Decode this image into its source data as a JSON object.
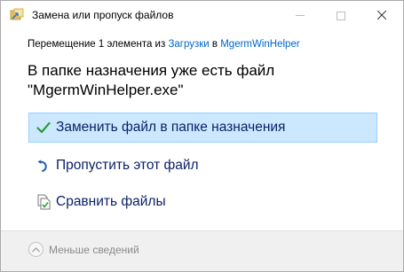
{
  "window": {
    "title": "Замена или пропуск файлов"
  },
  "subtitle": {
    "prefix": "Перемещение 1 элемента из ",
    "source": "Загрузки",
    "middle": " в ",
    "destination": "MgermWinHelper"
  },
  "heading": {
    "line1": "В папке назначения уже есть файл",
    "line2": "\"MgermWinHelper.exe\""
  },
  "options": [
    {
      "label": "Заменить файл в папке назначения",
      "icon": "check-icon",
      "selected": true
    },
    {
      "label": "Пропустить этот файл",
      "icon": "skip-arrow-icon",
      "selected": false
    },
    {
      "label": "Сравнить файлы",
      "icon": "compare-files-icon",
      "selected": false
    }
  ],
  "footer": {
    "details_label": "Меньше сведений"
  },
  "colors": {
    "selected_bg": "#cce8ff",
    "selected_border": "#99d1ff",
    "option_text": "#0a1f66",
    "link": "#0066cc",
    "check": "#2a9d3a",
    "footer_bg": "#f0f0f0"
  }
}
